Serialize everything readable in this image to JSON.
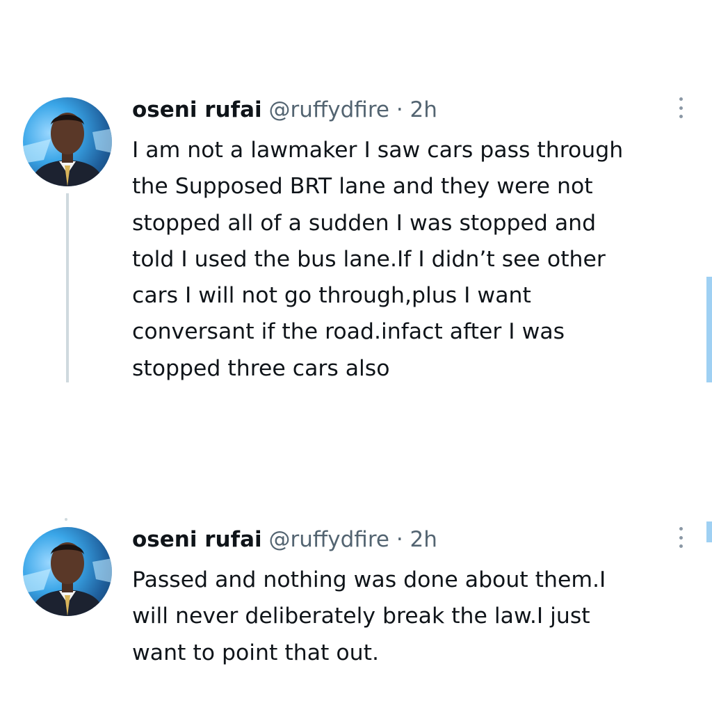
{
  "tweets": [
    {
      "author": {
        "name": "oseni rufai",
        "handle": "@ruffydfire"
      },
      "separator": "·",
      "time": "2h",
      "text": "I am not a lawmaker I saw cars pass through\nthe Supposed BRT lane and they were not\nstopped all of a sudden I was stopped and\ntold I used the bus lane.If I didn’t see other\ncars I will not go through,plus I want\nconversant if the road.infact after I was\nstopped three cars also",
      "more_icon": "more-vertical-icon"
    },
    {
      "author": {
        "name": "oseni rufai",
        "handle": "@ruffydfire"
      },
      "separator": "·",
      "time": "2h",
      "text": "Passed and nothing was done about them.I\nwill never deliberately break the law.I just\nwant to point that out.",
      "more_icon": "more-vertical-icon"
    }
  ],
  "colors": {
    "text": "#0f1419",
    "secondary": "#536471",
    "thread_line": "#cfd9de",
    "accent": "#1d9bf0"
  }
}
